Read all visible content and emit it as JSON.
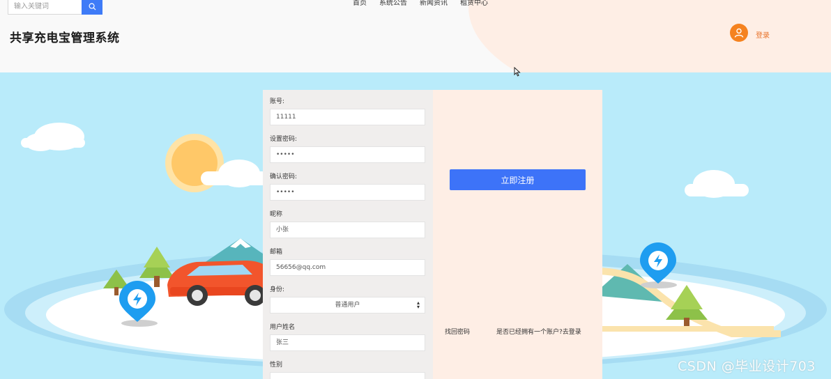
{
  "header": {
    "search": {
      "placeholder": "输入关键词",
      "value": ""
    },
    "nav": [
      "首页",
      "系统公告",
      "新闻资讯",
      "租赁中心"
    ],
    "site_title": "共享充电宝管理系统",
    "login_label": "登录"
  },
  "form": {
    "fields": [
      {
        "label": "账号:",
        "value": "11111"
      },
      {
        "label": "设置密码:",
        "value": "•••••"
      },
      {
        "label": "确认密码:",
        "value": "•••••"
      },
      {
        "label": "昵称",
        "value": "小张"
      },
      {
        "label": "邮箱",
        "value": "56656@qq.com"
      },
      {
        "label": "身份:",
        "value": "普通用户"
      },
      {
        "label": "用户姓名",
        "value": "张三"
      },
      {
        "label": "性别",
        "value": ""
      }
    ],
    "register_label": "立即注册",
    "forgot_label": "找回密码",
    "have_account_label": "是否已经拥有一个账户?去登录"
  },
  "watermark": "CSDN @毕业设计703",
  "colors": {
    "accent": "#3d73f8",
    "orange": "#f5821f",
    "sky": "#b9ebfa",
    "peach": "#feeee5"
  }
}
